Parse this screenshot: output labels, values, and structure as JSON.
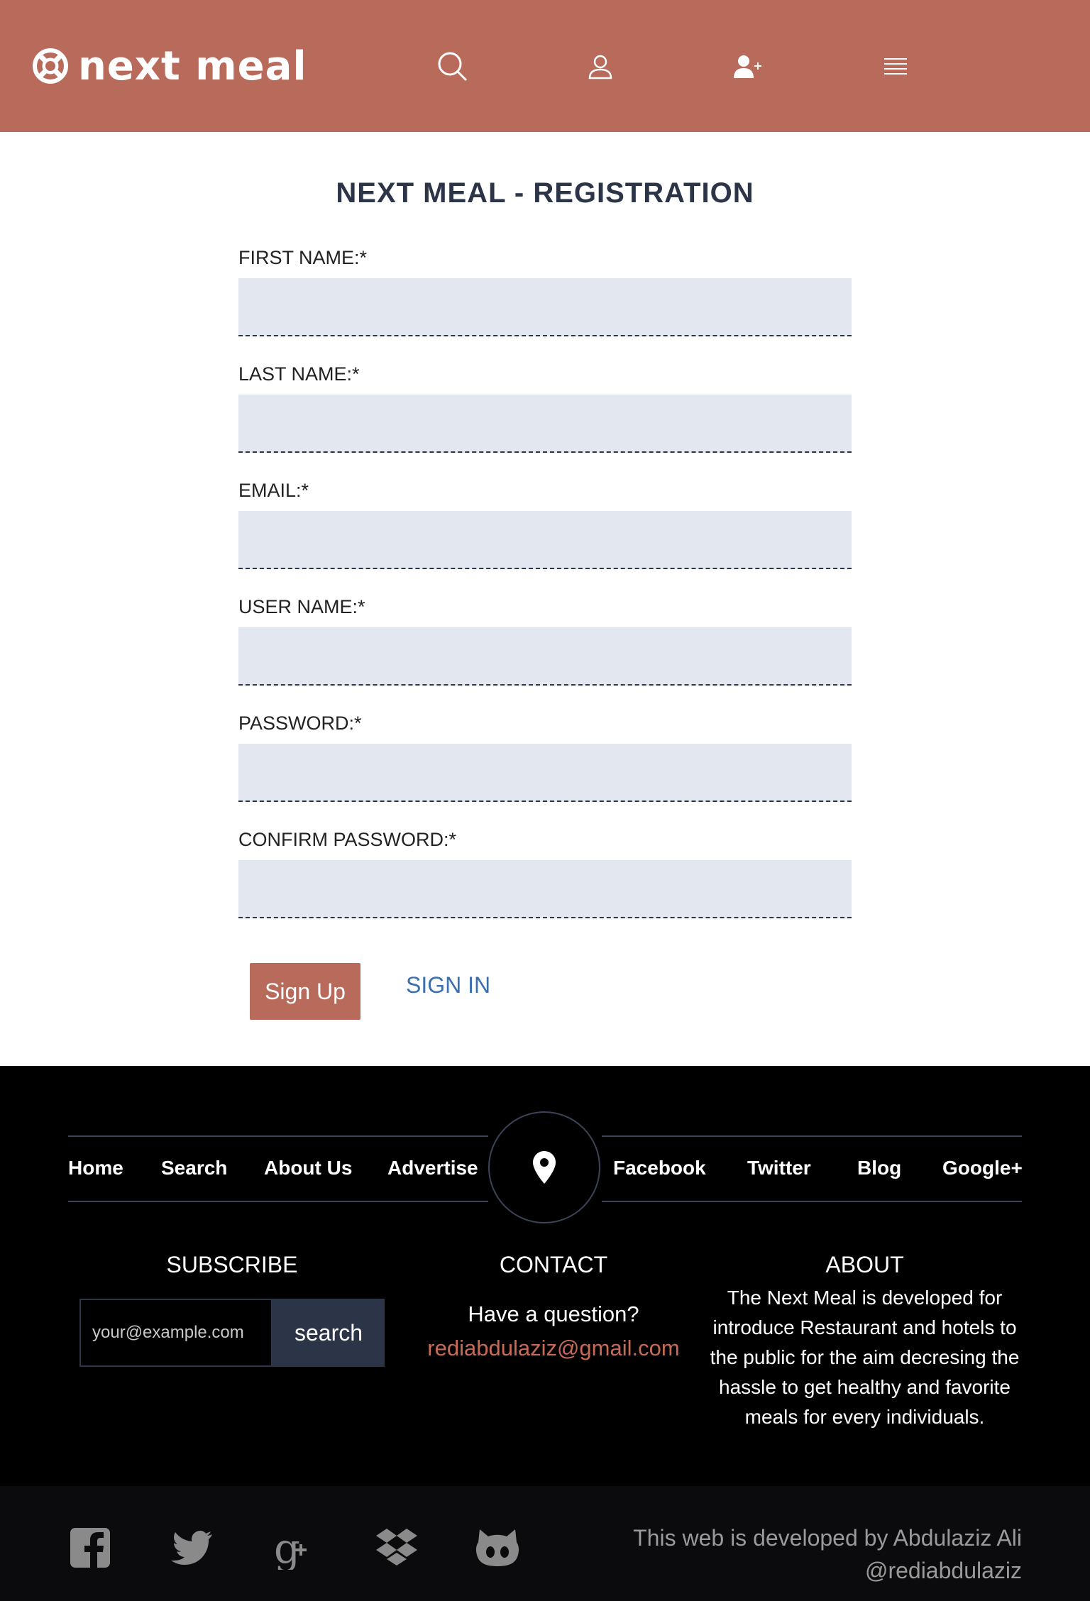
{
  "header": {
    "brand": "next meal",
    "nav_icons": [
      "search-icon",
      "user-icon",
      "add-user-icon",
      "menu-icon"
    ],
    "background": "#b86a5b"
  },
  "form": {
    "title": "NEXT MEAL - REGISTRATION",
    "fields": [
      {
        "label": "FIRST NAME:*",
        "value": ""
      },
      {
        "label": "LAST NAME:*",
        "value": ""
      },
      {
        "label": "EMAIL:*",
        "value": ""
      },
      {
        "label": "USER NAME:*",
        "value": ""
      },
      {
        "label": "PASSWORD:*",
        "value": ""
      },
      {
        "label": "CONFIRM PASSWORD:*",
        "value": ""
      }
    ],
    "submit_label": "Sign Up",
    "signin_label": "SIGN IN"
  },
  "footer": {
    "nav_left": [
      "Home",
      "Search",
      "About Us",
      "Advertise"
    ],
    "nav_right": [
      "Facebook",
      "Twitter",
      "Blog",
      "Google+"
    ],
    "subscribe": {
      "title": "SUBSCRIBE",
      "placeholder": "your@example.com",
      "button": "search"
    },
    "contact": {
      "title": "CONTACT",
      "question": "Have a question?",
      "email": "rediabdulaziz@gmail.com"
    },
    "about": {
      "title": "ABOUT",
      "text": "The Next Meal is developed for introduce Restaurant and hotels to the public for the aim decresing the hassle to get healthy and favorite meals for every individuals."
    },
    "social_icons": [
      "facebook-icon",
      "twitter-icon",
      "google-plus-icon",
      "dropbox-icon",
      "github-icon"
    ],
    "credit_line1": "This web is developed by Abdulaziz Ali",
    "credit_line2": "@rediabdulaziz",
    "accent": "#c96a57"
  }
}
